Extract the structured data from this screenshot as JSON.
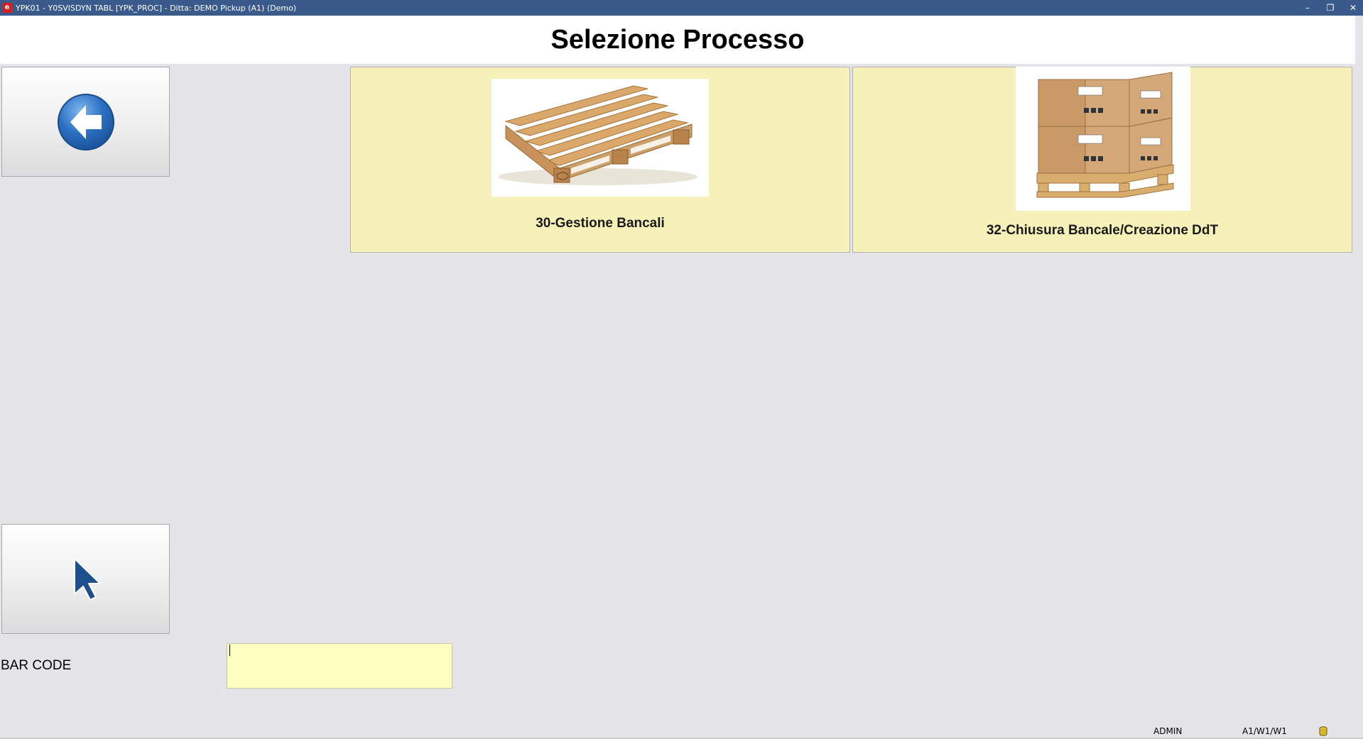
{
  "window": {
    "title": "YPK01 - Y0SVISDYN TABL [YPK_PROC] - Ditta: DEMO Pickup (A1)  (Demo)",
    "app_icon_glyph": "e",
    "minimize_glyph": "–",
    "restore_glyph": "❐",
    "close_glyph": "✕"
  },
  "page": {
    "title": "Selezione Processo"
  },
  "processes": [
    {
      "label": "30-Gestione Bancali",
      "icon": "wooden-pallet-image"
    },
    {
      "label": "32-Chiusura Bancale/Creazione DdT",
      "icon": "boxes-on-pallet-image"
    }
  ],
  "barcode": {
    "label": "BAR CODE",
    "value": ""
  },
  "status": {
    "user": "ADMIN",
    "location": "A1/W1/W1"
  },
  "colors": {
    "titlebar": "#3a5a8c",
    "tile_bg": "#f5f1b8",
    "input_bg": "#ffffc2",
    "back_arrow": "#2a6fc2",
    "pointer": "#1d4f8c"
  }
}
